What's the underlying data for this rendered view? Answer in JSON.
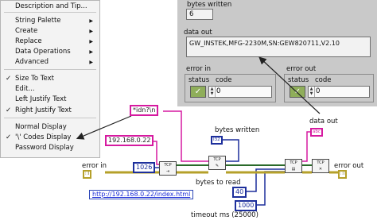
{
  "context_menu": {
    "items": [
      {
        "label": "Description and Tip...",
        "submenu": false,
        "checked": false
      },
      {
        "label": "String Palette",
        "submenu": true,
        "checked": false
      },
      {
        "label": "Create",
        "submenu": true,
        "checked": false
      },
      {
        "label": "Replace",
        "submenu": true,
        "checked": false
      },
      {
        "label": "Data Operations",
        "submenu": true,
        "checked": false
      },
      {
        "label": "Advanced",
        "submenu": true,
        "checked": false
      },
      {
        "label": "Size To Text",
        "submenu": false,
        "checked": true
      },
      {
        "label": "Edit...",
        "submenu": false,
        "checked": false
      },
      {
        "label": "Left Justify Text",
        "submenu": false,
        "checked": false
      },
      {
        "label": "Right Justify Text",
        "submenu": false,
        "checked": true
      },
      {
        "label": "Normal Display",
        "submenu": false,
        "checked": false
      },
      {
        "label": "'\\' Codes Display",
        "submenu": false,
        "checked": true
      },
      {
        "label": "Password Display",
        "submenu": false,
        "checked": false
      }
    ],
    "check_glyph": "✓",
    "arrow_glyph": "▶"
  },
  "front_panel": {
    "bytes_written_label": "bytes written",
    "bytes_written_value": "6",
    "data_out_label": "data out",
    "data_out_value": "GW_INSTEK,MFG-2230M,SN:GEW820711,V2.10",
    "error_in": {
      "title": "error in",
      "status_label": "status",
      "code_label": "code",
      "status_glyph": "✓",
      "code_value": "0"
    },
    "error_out": {
      "title": "error out",
      "status_label": "status",
      "code_label": "code",
      "status_glyph": "✓",
      "code_value": "0"
    }
  },
  "block_diagram": {
    "command_constant": "*idn?\\n",
    "ip_constant": "192.168.0.22",
    "port_constant": "1026",
    "bytes_to_read_constant": "40",
    "timeout_constant": "1000",
    "url_link": "http://192.168.0.22/index.html",
    "labels": {
      "bytes_written": "bytes written",
      "data_out": "data out",
      "error_in": "error in",
      "error_out": "error out",
      "bytes_to_read": "bytes to read",
      "timeout": "timeout ms (25000)"
    },
    "terminals": {
      "bytes_written_ind": "I32",
      "data_out_ind": "abc",
      "error_in_ctl": "∷I",
      "error_out_ind": "∷I"
    },
    "vi_labels": {
      "open": "TCP",
      "write": "TCP",
      "read": "TCP",
      "close": "TCP"
    }
  },
  "colors": {
    "menu_bg": "#f3f3f3",
    "panel_bg": "#c9c9c9",
    "string_wire": "#d61aa0",
    "numeric_wire": "#1d2f9c",
    "error_wire": "#b5a02a",
    "tcp_wire": "#2a6a2a",
    "status_green": "#8fae5a"
  }
}
